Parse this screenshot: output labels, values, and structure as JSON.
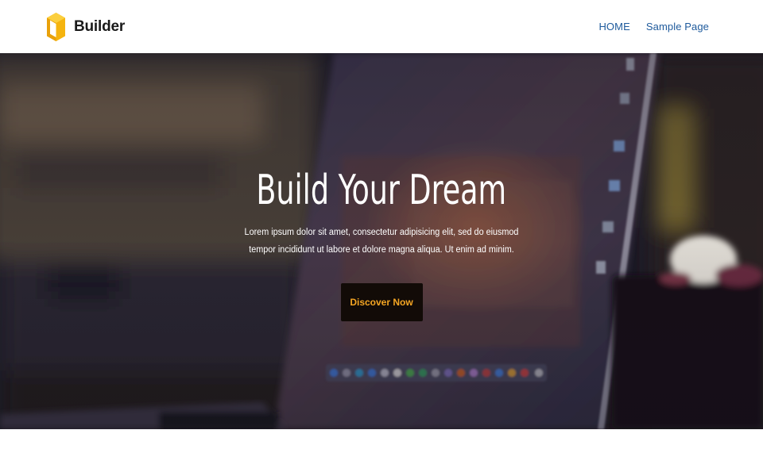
{
  "header": {
    "brand_name": "Builder",
    "logo_icon": "cube-logo",
    "nav": [
      {
        "label": "HOME"
      },
      {
        "label": "Sample Page"
      }
    ]
  },
  "hero": {
    "title": "Build Your Dream",
    "text": "Lorem ipsum dolor sit amet, consectetur adipisicing elit, sed do eiusmod tempor incididunt ut labore et dolore magna aliqua. Ut enim ad minim.",
    "button_label": "Discover Now",
    "background": "blurred-laptop-photo"
  },
  "colors": {
    "brand_accent": "#f5b40f",
    "nav_link": "#1e5a9c",
    "button_bg": "#120b07",
    "button_text": "#f5a623",
    "hero_text": "#ffffff"
  }
}
